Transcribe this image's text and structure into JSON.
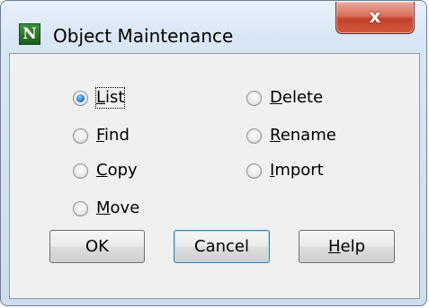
{
  "window": {
    "title": "Object Maintenance",
    "icon_letter": "N",
    "close_glyph": "x"
  },
  "options": {
    "list": {
      "label": "List",
      "mnemonic": "L",
      "rest": "ist",
      "selected": true
    },
    "find": {
      "label": "Find",
      "mnemonic": "F",
      "rest": "ind",
      "selected": false
    },
    "copy": {
      "label": "Copy",
      "mnemonic": "C",
      "rest": "opy",
      "selected": false
    },
    "move": {
      "label": "Move",
      "mnemonic": "M",
      "rest": "ove",
      "selected": false
    },
    "delete": {
      "label": "Delete",
      "mnemonic": "D",
      "rest": "elete",
      "selected": false
    },
    "rename": {
      "label": "Rename",
      "mnemonic": "R",
      "rest": "ename",
      "selected": false
    },
    "import": {
      "label": "Import",
      "mnemonic": "I",
      "rest": "mport",
      "selected": false
    }
  },
  "buttons": {
    "ok": {
      "label": "OK"
    },
    "cancel": {
      "label": "Cancel"
    },
    "help": {
      "label": "Help",
      "mnemonic": "H",
      "rest": "elp"
    }
  },
  "colors": {
    "radio_selected": "#2f7fd0",
    "close_button": "#c4412b",
    "default_button_border": "#3c7fb1"
  }
}
